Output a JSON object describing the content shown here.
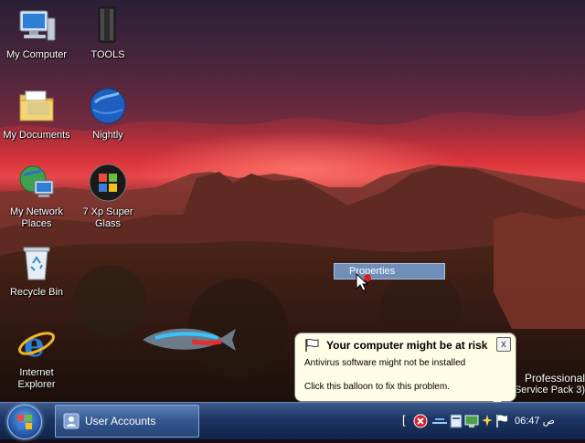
{
  "desktop": {
    "icons": [
      {
        "label": "My Computer",
        "icon": "computer-icon"
      },
      {
        "label": "TOOLS",
        "icon": "tools-folder-icon"
      },
      {
        "label": "My Documents",
        "icon": "documents-folder-icon"
      },
      {
        "label": "Nightly",
        "icon": "nightly-globe-icon"
      },
      {
        "label": "My Network\nPlaces",
        "icon": "network-places-icon"
      },
      {
        "label": "7 Xp Super\nGlass",
        "icon": "windows-orb-icon"
      },
      {
        "label": "Recycle Bin",
        "icon": "recycle-bin-icon"
      },
      {
        "label": "Internet\nExplorer",
        "icon": "internet-explorer-icon"
      }
    ]
  },
  "context_menu": {
    "item": "Properties"
  },
  "balloon": {
    "title": "Your computer might be at risk",
    "line1": "Antivirus software might not be installed",
    "line2": "Click this balloon to fix this problem.",
    "close": "x"
  },
  "edition": {
    "line1": "Professional",
    "line2": "Service Pack 3)"
  },
  "taskbar": {
    "start_icon": "windows-start-orb-icon",
    "task_label": "User Accounts",
    "clock": "06:47 ص"
  },
  "colors": {
    "taskbar": "#1c3563",
    "balloon_bg": "#fffde6",
    "alert_red": "#d3202b"
  }
}
